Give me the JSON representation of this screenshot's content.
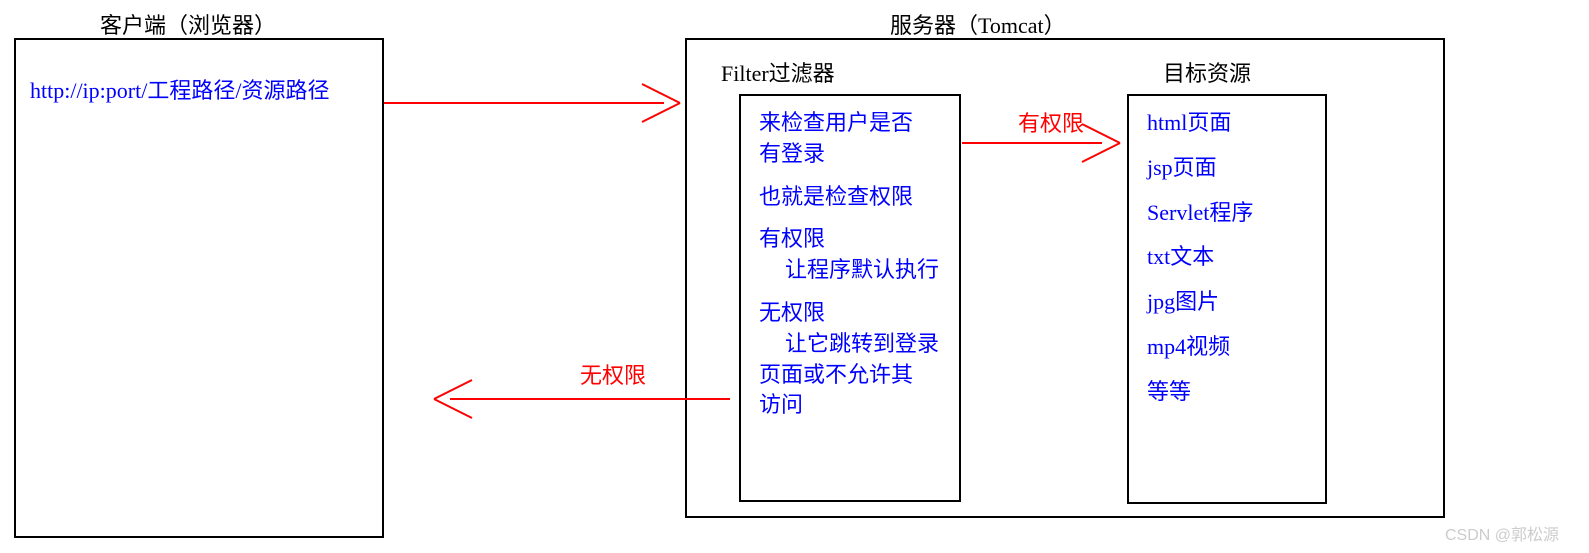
{
  "client": {
    "title": "客户端（浏览器）",
    "url": "http://ip:port/工程路径/资源路径"
  },
  "server": {
    "title": "服务器（Tomcat）",
    "filter": {
      "title": "Filter过滤器",
      "line1": "来检查用户是否",
      "line2": "有登录",
      "line3": "也就是检查权限",
      "line4": "有权限",
      "line5": "让程序默认执行",
      "line6": "无权限",
      "line7": "让它跳转到登录",
      "line8": "页面或不允许其",
      "line9": "访问"
    },
    "resource": {
      "title": "目标资源",
      "items": {
        "r1": "html页面",
        "r2": "jsp页面",
        "r3": "Servlet程序",
        "r4": "txt文本",
        "r5": "jpg图片",
        "r6": "mp4视频",
        "r7": "等等"
      }
    }
  },
  "arrows": {
    "request": "",
    "hasPermission": "有权限",
    "noPermission": "无权限"
  },
  "watermark": "CSDN @郭松源"
}
